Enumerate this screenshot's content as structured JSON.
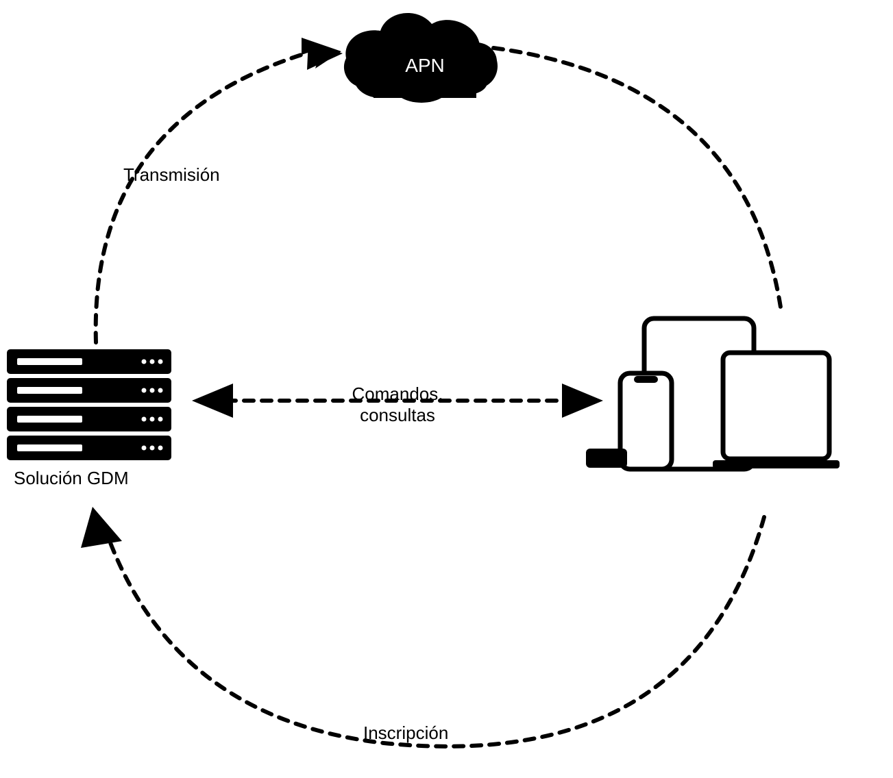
{
  "nodes": {
    "cloud": {
      "label": "APN"
    },
    "server": {
      "label": "Solución GDM"
    }
  },
  "edges": {
    "transmission": {
      "label": "Transmisión"
    },
    "commands": {
      "label_line1": "Comandos,",
      "label_line2": "consultas"
    },
    "enrollment": {
      "label": "Inscripción"
    }
  }
}
